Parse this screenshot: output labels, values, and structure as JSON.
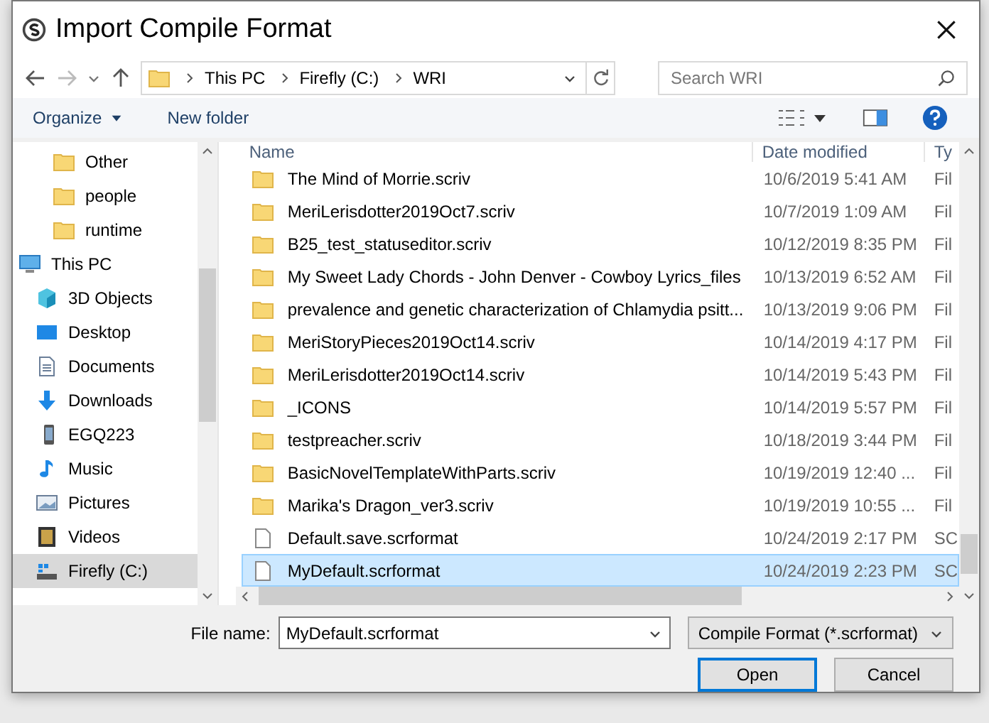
{
  "window": {
    "title": "Import Compile Format"
  },
  "nav": {
    "path": [
      "This PC",
      "Firefly (C:)",
      "WRI"
    ],
    "search": {
      "placeholder": "Search WRI"
    }
  },
  "toolbar": {
    "organize": "Organize",
    "new_folder": "New folder"
  },
  "sidebar": {
    "items": [
      {
        "children": [
          {
            "label": "Other",
            "kind": "folder",
            "selected": false
          },
          {
            "label": "people",
            "kind": "folder",
            "selected": false
          },
          {
            "label": "runtime",
            "kind": "folder",
            "selected": false
          }
        ]
      },
      {
        "label": "This PC",
        "kind": "pc",
        "selected": false,
        "children": [
          {
            "label": "3D Objects",
            "kind": "cube",
            "selected": false
          },
          {
            "label": "Desktop",
            "kind": "desktop",
            "selected": false
          },
          {
            "label": "Documents",
            "kind": "documents",
            "selected": false
          },
          {
            "label": "Downloads",
            "kind": "download",
            "selected": false
          },
          {
            "label": "EGQ223",
            "kind": "device",
            "selected": false
          },
          {
            "label": "Music",
            "kind": "music",
            "selected": false
          },
          {
            "label": "Pictures",
            "kind": "pictures",
            "selected": false
          },
          {
            "label": "Videos",
            "kind": "videos",
            "selected": false
          },
          {
            "label": "Firefly (C:)",
            "kind": "drive",
            "selected": true
          }
        ]
      }
    ]
  },
  "table": {
    "columns": [
      "Name",
      "Date modified",
      "Ty"
    ],
    "rows": [
      {
        "kind": "folder",
        "name": "The Mind of Morrie.scriv",
        "date": "10/6/2019 5:41 AM",
        "column_3": "Fil",
        "selected": false
      },
      {
        "kind": "folder",
        "name": "MeriLerisdotter2019Oct7.scriv",
        "date": "10/7/2019 1:09 AM",
        "column_3": "Fil",
        "selected": false
      },
      {
        "kind": "folder",
        "name": "B25_test_statuseditor.scriv",
        "date": "10/12/2019 8:35 PM",
        "column_3": "Fil",
        "selected": false
      },
      {
        "kind": "folder",
        "name": "My Sweet Lady Chords - John Denver - Cowboy Lyrics_files",
        "date": "10/13/2019 6:52 AM",
        "column_3": "Fil",
        "selected": false
      },
      {
        "kind": "folder",
        "name": "prevalence and genetic characterization of Chlamydia psitt...",
        "date": "10/13/2019 9:06 PM",
        "column_3": "Fil",
        "selected": false
      },
      {
        "kind": "folder",
        "name": "MeriStoryPieces2019Oct14.scriv",
        "date": "10/14/2019 4:17 PM",
        "column_3": "Fil",
        "selected": false
      },
      {
        "kind": "folder",
        "name": "MeriLerisdotter2019Oct14.scriv",
        "date": "10/14/2019 5:43 PM",
        "column_3": "Fil",
        "selected": false
      },
      {
        "kind": "folder",
        "name": "_ICONS",
        "date": "10/14/2019 5:57 PM",
        "column_3": "Fil",
        "selected": false
      },
      {
        "kind": "folder",
        "name": "testpreacher.scriv",
        "date": "10/18/2019 3:44 PM",
        "column_3": "Fil",
        "selected": false
      },
      {
        "kind": "folder",
        "name": "BasicNovelTemplateWithParts.scriv",
        "date": "10/19/2019 12:40 ...",
        "column_3": "Fil",
        "selected": false
      },
      {
        "kind": "folder",
        "name": "Marika's Dragon_ver3.scriv",
        "date": "10/19/2019 10:55 ...",
        "column_3": "Fil",
        "selected": false
      },
      {
        "kind": "file",
        "name": "Default.save.scrformat",
        "date": "10/24/2019 2:17 PM",
        "column_3": "SC",
        "selected": false
      },
      {
        "kind": "file",
        "name": "MyDefault.scrformat",
        "date": "10/24/2019 2:23 PM",
        "column_3": "SC",
        "selected": true
      }
    ]
  },
  "footer": {
    "file_name_label": "File name:",
    "file_name": "MyDefault.scrformat",
    "file_type": "Compile Format (*.scrformat)",
    "buttons": [
      "Open",
      "Cancel"
    ]
  }
}
